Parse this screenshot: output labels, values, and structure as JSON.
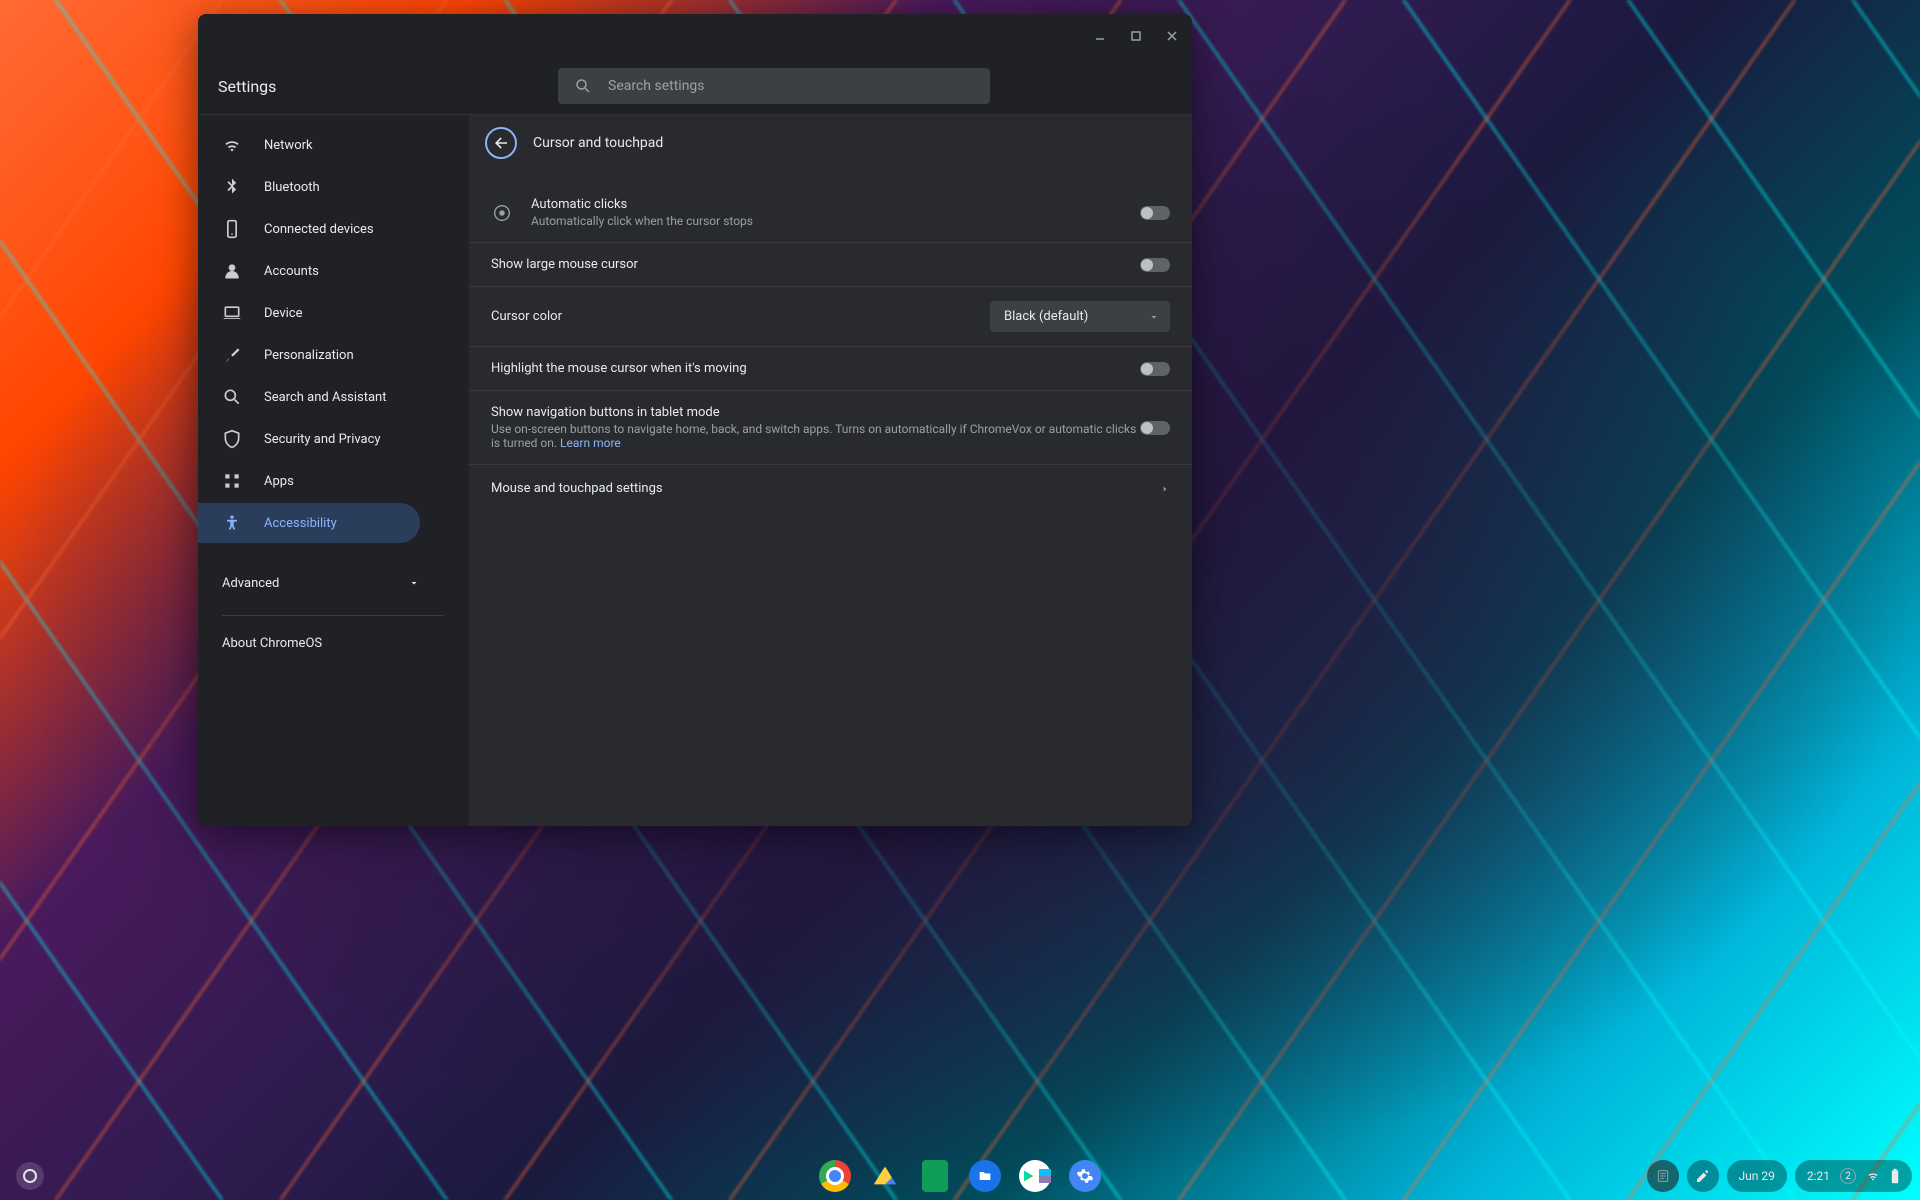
{
  "app_title": "Settings",
  "search": {
    "placeholder": "Search settings"
  },
  "sidebar": {
    "items": [
      {
        "label": "Network"
      },
      {
        "label": "Bluetooth"
      },
      {
        "label": "Connected devices"
      },
      {
        "label": "Accounts"
      },
      {
        "label": "Device"
      },
      {
        "label": "Personalization"
      },
      {
        "label": "Search and Assistant"
      },
      {
        "label": "Security and Privacy"
      },
      {
        "label": "Apps"
      },
      {
        "label": "Accessibility"
      }
    ],
    "advanced": "Advanced",
    "about": "About ChromeOS"
  },
  "content": {
    "title": "Cursor and touchpad",
    "auto_clicks": {
      "title": "Automatic clicks",
      "desc": "Automatically click when the cursor stops"
    },
    "large_cursor": "Show large mouse cursor",
    "cursor_color": {
      "label": "Cursor color",
      "value": "Black (default)"
    },
    "highlight": "Highlight the mouse cursor when it's moving",
    "tablet_nav": {
      "title": "Show navigation buttons in tablet mode",
      "desc": "Use on-screen buttons to navigate home, back, and switch apps. Turns on automatically if ChromeVox or automatic clicks is turned on. ",
      "link": "Learn more"
    },
    "mouse_touchpad": "Mouse and touchpad settings"
  },
  "shelf": {
    "date": "Jun 29",
    "time": "2:21",
    "badge": "2"
  }
}
